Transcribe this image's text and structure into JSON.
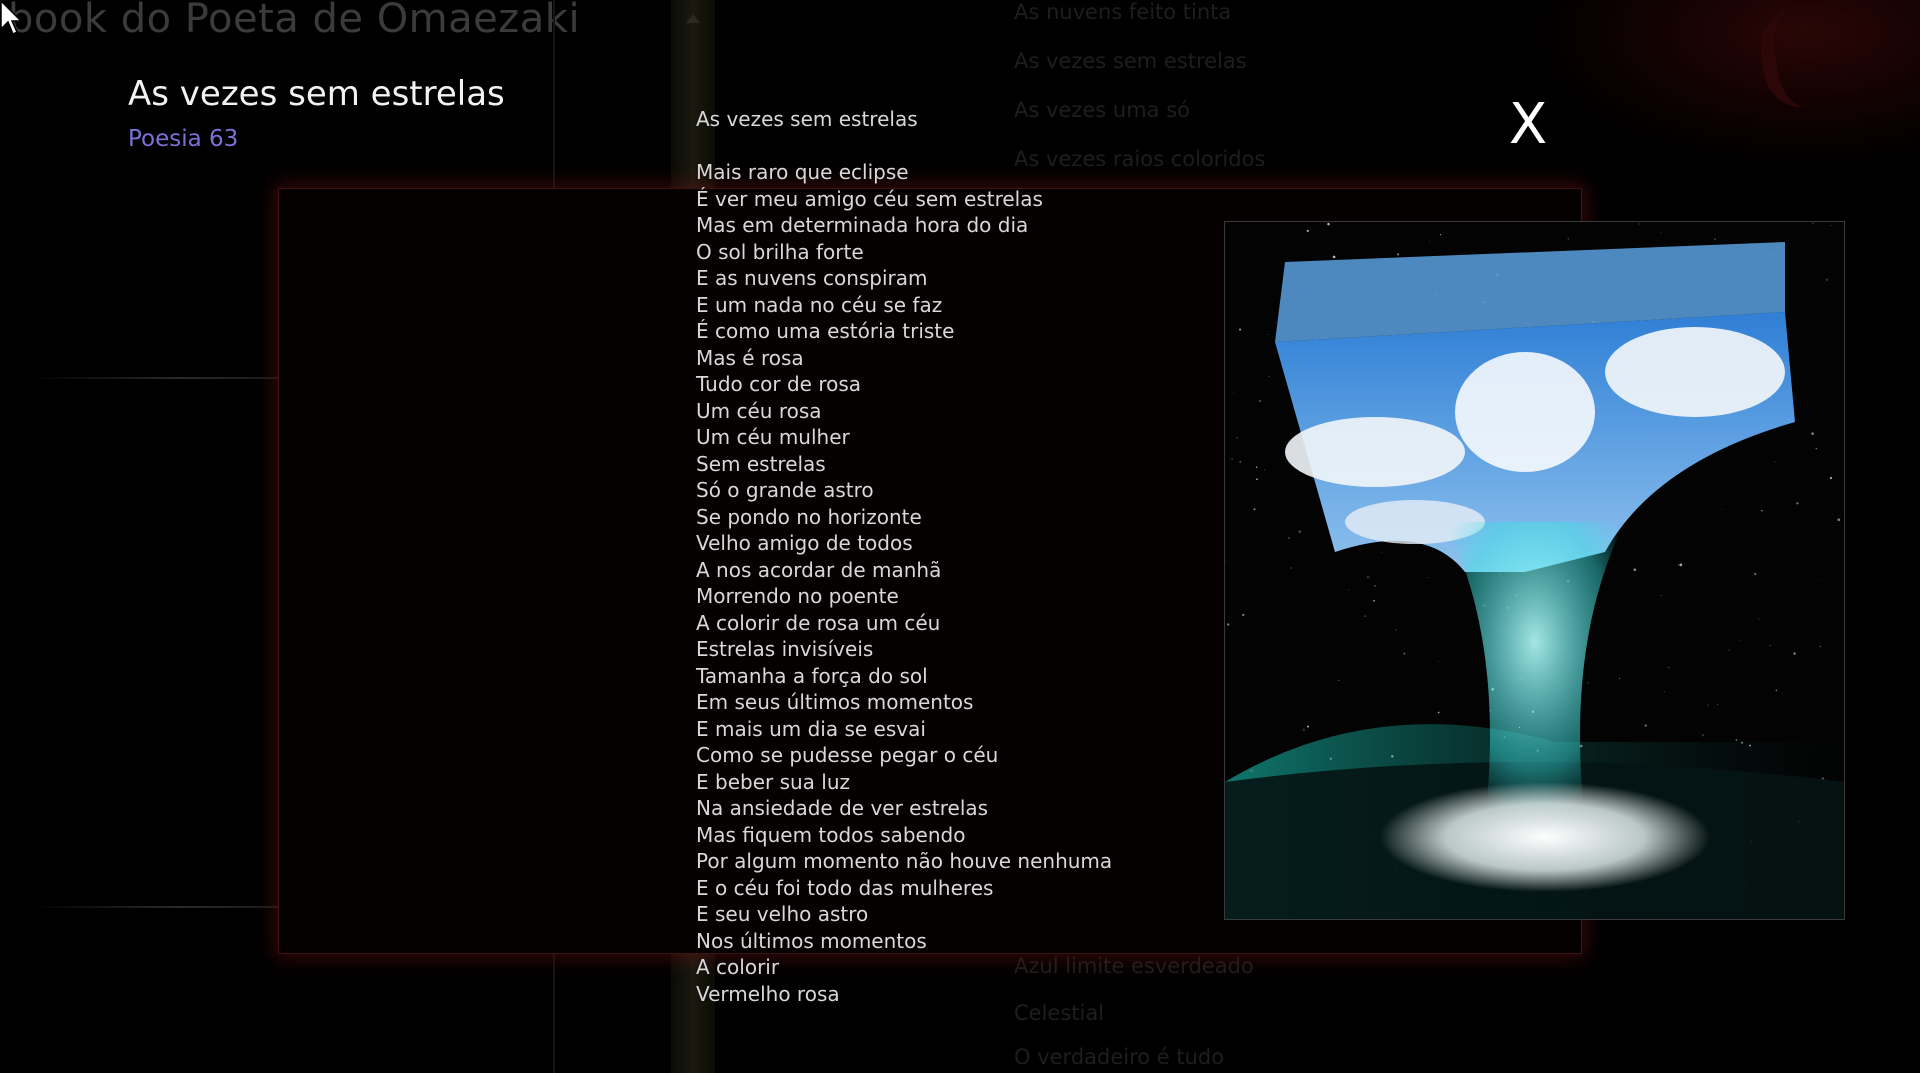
{
  "app": {
    "title": "book do Poeta de Omaezaki"
  },
  "background_list": {
    "top": [
      "As nuvens feito tinta",
      "As vezes sem estrelas",
      "As vezes uma só",
      "As vezes raios coloridos"
    ],
    "bottom": [
      "Azul limite esverdeado",
      "Celestial",
      "O verdadeiro é tudo"
    ]
  },
  "poem_header": {
    "title": "As vezes sem estrelas",
    "number": "Poesia 63"
  },
  "modal": {
    "close_label": "X",
    "poem_title": "As vezes sem estrelas",
    "lines": [
      "Mais raro que eclipse",
      "É ver meu amigo céu sem estrelas",
      "Mas em determinada hora do dia",
      "O sol brilha forte",
      "E as nuvens conspiram",
      "E um nada no céu se faz",
      "É como uma estória triste",
      "Mas é rosa",
      "Tudo cor de rosa",
      "Um céu rosa",
      "Um céu mulher",
      "Sem estrelas",
      "Só o grande astro",
      "Se pondo no horizonte",
      "Velho amigo de todos",
      "A nos acordar de manhã",
      "Morrendo no poente",
      "A colorir de rosa um céu",
      "Estrelas invisíveis",
      "Tamanha a força do sol",
      "Em seus últimos momentos",
      "E mais um dia se esvai",
      "Como se pudesse pegar o céu",
      "E beber sua luz",
      "Na ansiedade de ver estrelas",
      "Mas fiquem todos sabendo",
      "Por algum momento não houve nenhuma",
      "E o céu foi todo das mulheres",
      "E seu velho astro",
      "Nos últimos momentos",
      "A colorir",
      "Vermelho rosa"
    ]
  },
  "colors": {
    "accent": "#7b72d8",
    "panel_border": "#3c1212",
    "text": "#d8d8d8"
  }
}
